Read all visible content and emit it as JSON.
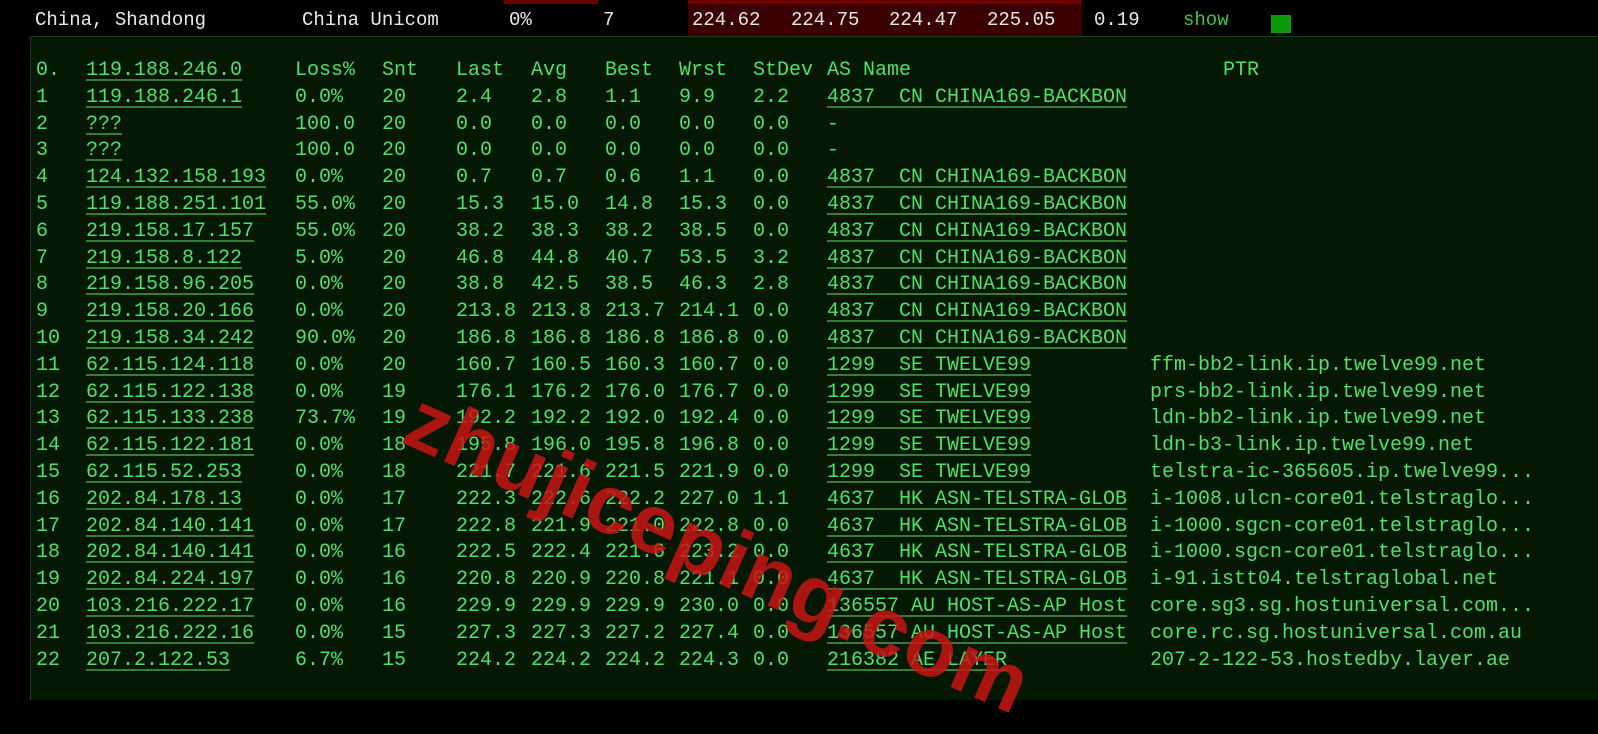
{
  "summary": {
    "location": "China, Shandong",
    "isp": "China Unicom",
    "loss": "0%",
    "sent": "7",
    "last": "224.62",
    "avg": "224.75",
    "best": "224.47",
    "worst": "225.05",
    "stdev": "0.19",
    "show_label": "show",
    "status_color": "#0a9a0a"
  },
  "header": {
    "idx": "0.",
    "host": "119.188.246.0",
    "loss": "Loss%",
    "snt": "Snt",
    "last": "Last",
    "avg": "Avg",
    "best": "Best",
    "wrst": "Wrst",
    "stdev": "StDev",
    "as": "AS Name",
    "ptr": "PTR"
  },
  "hops": [
    [
      "1",
      "119.188.246.1",
      "0.0%",
      "20",
      "2.4",
      "2.8",
      "1.1",
      "9.9",
      "2.2",
      "4837  CN CHINA169-BACKBON",
      ""
    ],
    [
      "2",
      "???",
      "100.0",
      "20",
      "0.0",
      "0.0",
      "0.0",
      "0.0",
      "0.0",
      "-",
      ""
    ],
    [
      "3",
      "???",
      "100.0",
      "20",
      "0.0",
      "0.0",
      "0.0",
      "0.0",
      "0.0",
      "-",
      ""
    ],
    [
      "4",
      "124.132.158.193",
      "0.0%",
      "20",
      "0.7",
      "0.7",
      "0.6",
      "1.1",
      "0.0",
      "4837  CN CHINA169-BACKBON",
      ""
    ],
    [
      "5",
      "119.188.251.101",
      "55.0%",
      "20",
      "15.3",
      "15.0",
      "14.8",
      "15.3",
      "0.0",
      "4837  CN CHINA169-BACKBON",
      ""
    ],
    [
      "6",
      "219.158.17.157",
      "55.0%",
      "20",
      "38.2",
      "38.3",
      "38.2",
      "38.5",
      "0.0",
      "4837  CN CHINA169-BACKBON",
      ""
    ],
    [
      "7",
      "219.158.8.122",
      "5.0%",
      "20",
      "46.8",
      "44.8",
      "40.7",
      "53.5",
      "3.2",
      "4837  CN CHINA169-BACKBON",
      ""
    ],
    [
      "8",
      "219.158.96.205",
      "0.0%",
      "20",
      "38.8",
      "42.5",
      "38.5",
      "46.3",
      "2.8",
      "4837  CN CHINA169-BACKBON",
      ""
    ],
    [
      "9",
      "219.158.20.166",
      "0.0%",
      "20",
      "213.8",
      "213.8",
      "213.7",
      "214.1",
      "0.0",
      "4837  CN CHINA169-BACKBON",
      ""
    ],
    [
      "10",
      "219.158.34.242",
      "90.0%",
      "20",
      "186.8",
      "186.8",
      "186.8",
      "186.8",
      "0.0",
      "4837  CN CHINA169-BACKBON",
      ""
    ],
    [
      "11",
      "62.115.124.118",
      "0.0%",
      "20",
      "160.7",
      "160.5",
      "160.3",
      "160.7",
      "0.0",
      "1299  SE TWELVE99",
      "ffm-bb2-link.ip.twelve99.net"
    ],
    [
      "12",
      "62.115.122.138",
      "0.0%",
      "19",
      "176.1",
      "176.2",
      "176.0",
      "176.7",
      "0.0",
      "1299  SE TWELVE99",
      "prs-bb2-link.ip.twelve99.net"
    ],
    [
      "13",
      "62.115.133.238",
      "73.7%",
      "19",
      "192.2",
      "192.2",
      "192.0",
      "192.4",
      "0.0",
      "1299  SE TWELVE99",
      "ldn-bb2-link.ip.twelve99.net"
    ],
    [
      "14",
      "62.115.122.181",
      "0.0%",
      "18",
      "195.8",
      "196.0",
      "195.8",
      "196.8",
      "0.0",
      "1299  SE TWELVE99",
      "ldn-b3-link.ip.twelve99.net"
    ],
    [
      "15",
      "62.115.52.253",
      "0.0%",
      "18",
      "221.7",
      "221.6",
      "221.5",
      "221.9",
      "0.0",
      "1299  SE TWELVE99",
      "telstra-ic-365605.ip.twelve99..."
    ],
    [
      "16",
      "202.84.178.13",
      "0.0%",
      "17",
      "222.3",
      "222.6",
      "222.2",
      "227.0",
      "1.1",
      "4637  HK ASN-TELSTRA-GLOB",
      "i-1008.ulcn-core01.telstraglo..."
    ],
    [
      "17",
      "202.84.140.141",
      "0.0%",
      "17",
      "222.8",
      "221.9",
      "221.0",
      "222.8",
      "0.0",
      "4637  HK ASN-TELSTRA-GLOB",
      "i-1000.sgcn-core01.telstraglo..."
    ],
    [
      "18",
      "202.84.140.141",
      "0.0%",
      "16",
      "222.5",
      "222.4",
      "221.6",
      "223.2",
      "0.0",
      "4637  HK ASN-TELSTRA-GLOB",
      "i-1000.sgcn-core01.telstraglo..."
    ],
    [
      "19",
      "202.84.224.197",
      "0.0%",
      "16",
      "220.8",
      "220.9",
      "220.8",
      "221.1",
      "0.0",
      "4637  HK ASN-TELSTRA-GLOB",
      "i-91.istt04.telstraglobal.net"
    ],
    [
      "20",
      "103.216.222.17",
      "0.0%",
      "16",
      "229.9",
      "229.9",
      "229.9",
      "230.0",
      "0.0",
      "136557 AU HOST-AS-AP Host",
      "core.sg3.sg.hostuniversal.com..."
    ],
    [
      "21",
      "103.216.222.16",
      "0.0%",
      "15",
      "227.3",
      "227.3",
      "227.2",
      "227.4",
      "0.0",
      "136557 AU HOST-AS-AP Host",
      "core.rc.sg.hostuniversal.com.au"
    ],
    [
      "22",
      "207.2.122.53",
      "6.7%",
      "15",
      "224.2",
      "224.2",
      "224.2",
      "224.3",
      "0.0",
      "216382 AE LAYER",
      "207-2-122-53.hostedby.layer.ae"
    ]
  ],
  "watermark": "zhujiceping.com"
}
